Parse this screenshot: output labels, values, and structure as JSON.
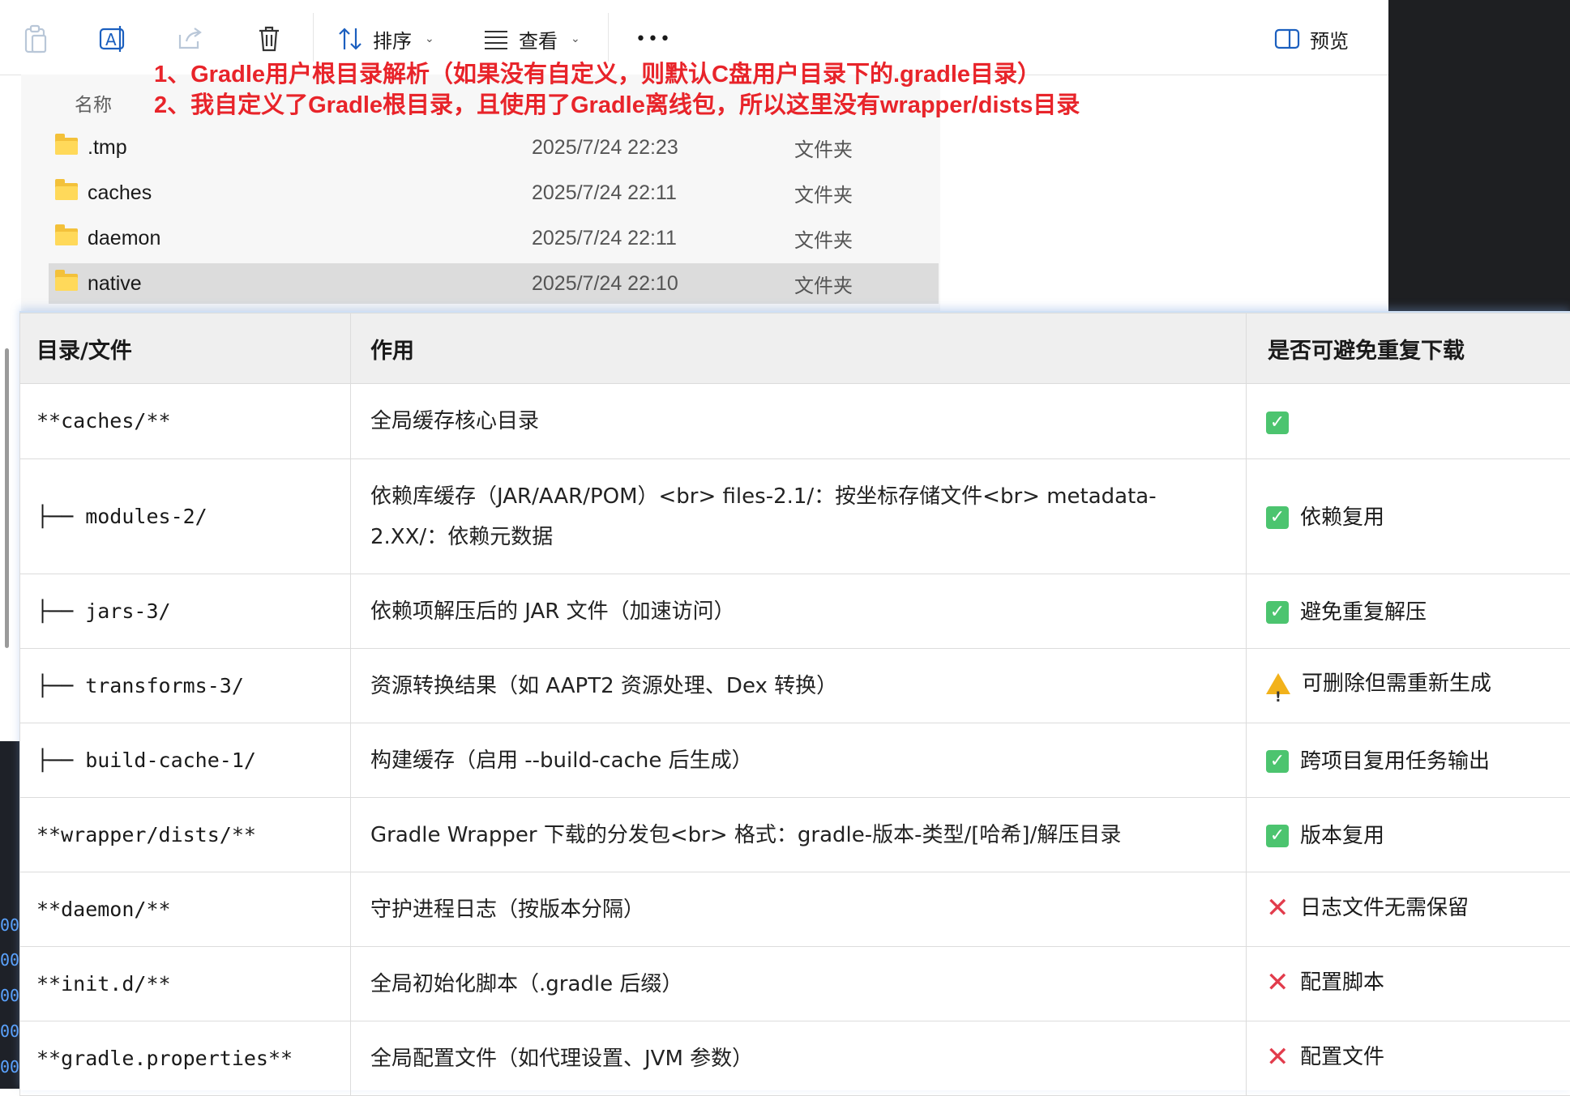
{
  "toolbar": {
    "sort_label": "排序",
    "view_label": "查看",
    "more_label": "•••",
    "preview_label": "预览"
  },
  "file_list": {
    "col_name": "名称",
    "rows": [
      {
        "name": ".tmp",
        "date": "2025/7/24 22:23",
        "type": "文件夹"
      },
      {
        "name": "caches",
        "date": "2025/7/24 22:11",
        "type": "文件夹"
      },
      {
        "name": "daemon",
        "date": "2025/7/24 22:11",
        "type": "文件夹"
      },
      {
        "name": "native",
        "date": "2025/7/24 22:10",
        "type": "文件夹"
      }
    ]
  },
  "annotation": {
    "line1": "1、Gradle用户根目录解析（如果没有自定义，则默认C盘用户目录下的.gradle目录）",
    "line2": "2、我自定义了Gradle根目录，且使用了Gradle离线包，所以这里没有wrapper/dists目录"
  },
  "table": {
    "headers": [
      "目录/文件",
      "作用",
      "是否可避免重复下载"
    ],
    "rows": [
      {
        "path": "**caches/**",
        "desc": "全局缓存核心目录",
        "status_icon": "check",
        "status": ""
      },
      {
        "path": "├── modules-2/",
        "desc": "依赖库缓存（JAR/AAR/POM）<br> files-2.1/：按坐标存储文件<br> metadata-2.XX/：依赖元数据",
        "status_icon": "check",
        "status": "依赖复用"
      },
      {
        "path": "├── jars-3/",
        "desc": "依赖项解压后的 JAR 文件（加速访问）",
        "status_icon": "check",
        "status": "避免重复解压"
      },
      {
        "path": "├── transforms-3/",
        "desc": "资源转换结果（如 AAPT2 资源处理、Dex 转换）",
        "status_icon": "warning",
        "status": "可删除但需重新生成"
      },
      {
        "path": "├── build-cache-1/",
        "desc": "构建缓存（启用 --build-cache 后生成）",
        "status_icon": "check",
        "status": "跨项目复用任务输出"
      },
      {
        "path": "**wrapper/dists/**",
        "desc": "Gradle Wrapper 下载的分发包<br> 格式：gradle-版本-类型/[哈希]/解压目录",
        "status_icon": "check",
        "status": "版本复用"
      },
      {
        "path": "**daemon/**",
        "desc": "守护进程日志（按版本分隔）",
        "status_icon": "cross",
        "status": "日志文件无需保留"
      },
      {
        "path": "**init.d/**",
        "desc": "全局初始化脚本（.gradle 后缀）",
        "status_icon": "cross",
        "status": "配置脚本"
      },
      {
        "path": "**gradle.properties**",
        "desc": "全局配置文件（如代理设置、JVM 参数）",
        "status_icon": "cross",
        "status": "配置文件"
      }
    ]
  },
  "colors": {
    "annotation": "#e8242a",
    "check": "#4cc46f",
    "cross": "#e23c4c",
    "warning": "#f2b21b"
  }
}
